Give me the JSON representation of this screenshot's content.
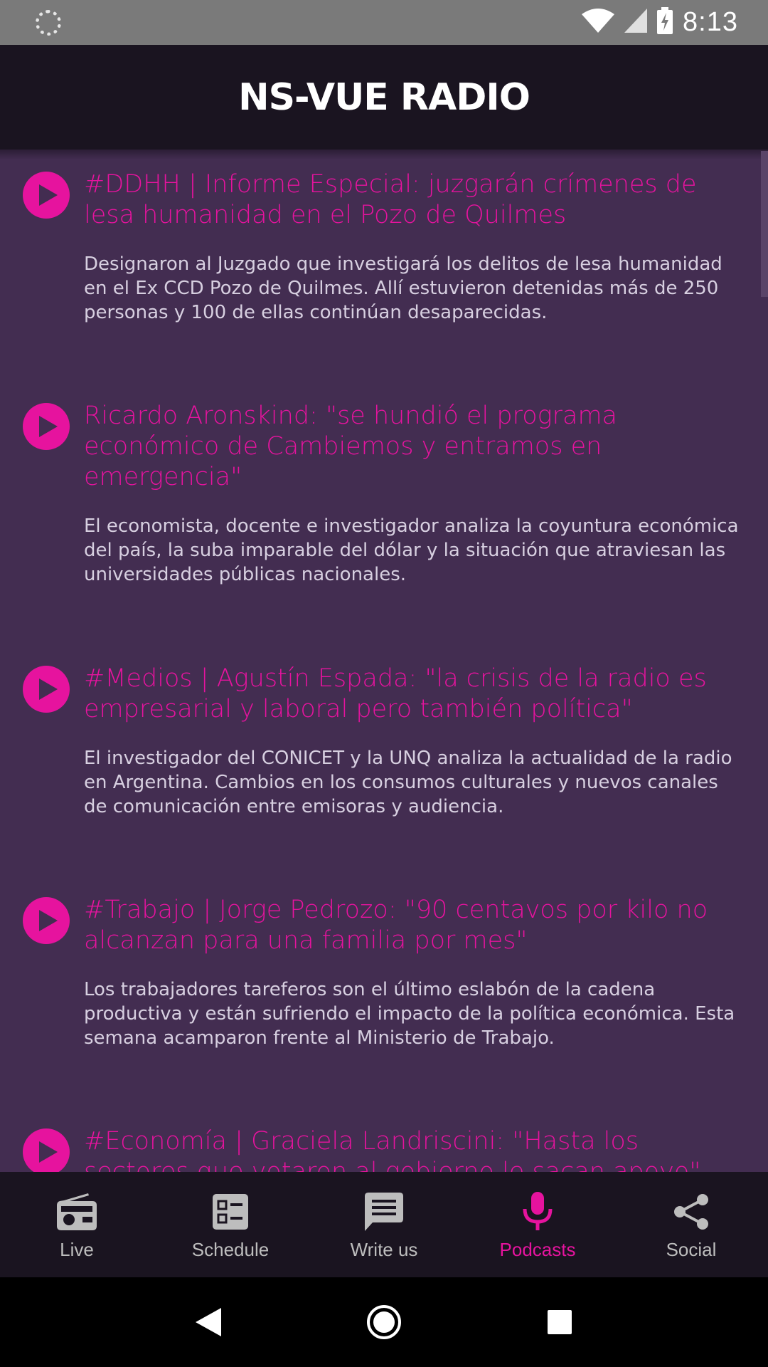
{
  "status_bar": {
    "time": "8:13",
    "icons": [
      "loading-icon",
      "wifi-icon",
      "signal-icon",
      "battery-charging-icon"
    ]
  },
  "app_bar": {
    "title": "NS-VUE RADIO"
  },
  "podcasts": [
    {
      "title": "#DDHH | Informe Especial: juzgarán crímenes de lesa humanidad en el Pozo de Quilmes",
      "description": "Designaron al Juzgado que investigará los delitos de lesa humanidad en el Ex CCD Pozo de Quilmes. Allí estuvieron detenidas más de 250 personas y 100 de ellas continúan desaparecidas."
    },
    {
      "title": "Ricardo Aronskind: \"se hundió el programa económico de Cambiemos y entramos en emergencia\"",
      "description": "El economista, docente e investigador analiza la coyuntura económica del país, la suba imparable del dólar y la situación que atraviesan las universidades públicas nacionales."
    },
    {
      "title": "#Medios | Agustín Espada: \"la crisis de la radio es empresarial y laboral pero también política\"",
      "description": "El investigador del CONICET y la UNQ analiza la actualidad de la radio en Argentina. Cambios en los consumos culturales y nuevos canales de comunicación entre emisoras y audiencia."
    },
    {
      "title": "#Trabajo  | Jorge Pedrozo: \"90 centavos por kilo no alcanzan para una familia por mes\"",
      "description": "Los trabajadores tareferos son el último eslabón de la cadena productiva y están sufriendo el impacto de la política económica. Esta semana acamparon frente al Ministerio de Trabajo."
    },
    {
      "title": "#Economía | Graciela Landriscini: \"Hasta los sectores que votaron al gobierno le sacan apoyo\"",
      "description": ""
    }
  ],
  "bottom_nav": [
    {
      "label": "Live",
      "icon": "radio-icon",
      "active": false
    },
    {
      "label": "Schedule",
      "icon": "schedule-icon",
      "active": false
    },
    {
      "label": "Write us",
      "icon": "message-icon",
      "active": false
    },
    {
      "label": "Podcasts",
      "icon": "microphone-icon",
      "active": true
    },
    {
      "label": "Social",
      "icon": "share-icon",
      "active": false
    }
  ],
  "system_nav": [
    "back-icon",
    "home-icon",
    "recents-icon"
  ],
  "colors": {
    "accent": "#e6139e",
    "content_bg": "#432d51",
    "bar_bg": "#1a1420",
    "description_text": "#d7cfe0"
  }
}
